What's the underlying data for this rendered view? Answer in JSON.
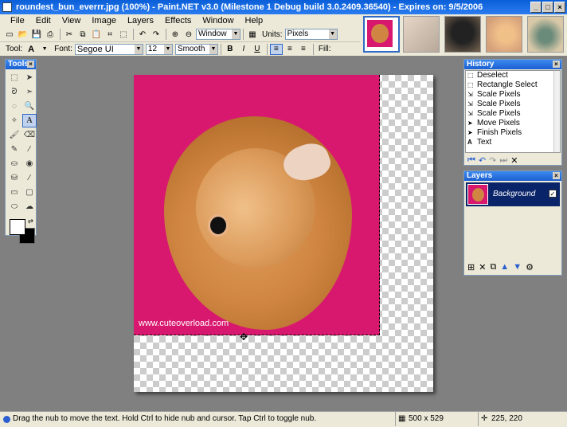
{
  "window": {
    "title": "roundest_bun_everrr.jpg (100%) - Paint.NET v3.0 (Milestone 1 Debug build 3.0.2409.36540) - Expires on: 9/5/2006",
    "min": "_",
    "max": "□",
    "close": "×"
  },
  "menu": [
    "File",
    "Edit",
    "View",
    "Image",
    "Layers",
    "Effects",
    "Window",
    "Help"
  ],
  "toolbar": {
    "zoom_value": "Window",
    "units_label": "Units:",
    "units_value": "Pixels"
  },
  "toolbar2": {
    "tool_label": "Tool:",
    "tool_value": "A",
    "font_label": "Font:",
    "font_value": "Segoe UI",
    "size_value": "12",
    "smoothing_value": "Smooth",
    "bold": "B",
    "italic": "I",
    "underline": "U",
    "fill_label": "Fill:"
  },
  "canvas": {
    "watermark": "www.cuteoverload.com"
  },
  "tools_panel": {
    "title": "Tools"
  },
  "history_panel": {
    "title": "History",
    "items": [
      "Deselect",
      "Rectangle Select",
      "Scale Pixels",
      "Scale Pixels",
      "Scale Pixels",
      "Move Pixels",
      "Finish Pixels",
      "Text"
    ]
  },
  "layers_panel": {
    "title": "Layers",
    "layer_name": "Background"
  },
  "status": {
    "message": "Drag the nub to move the text. Hold Ctrl to hide nub and cursor. Tap Ctrl to toggle nub.",
    "image_size": "500 x 529",
    "cursor_pos": "225, 220"
  }
}
